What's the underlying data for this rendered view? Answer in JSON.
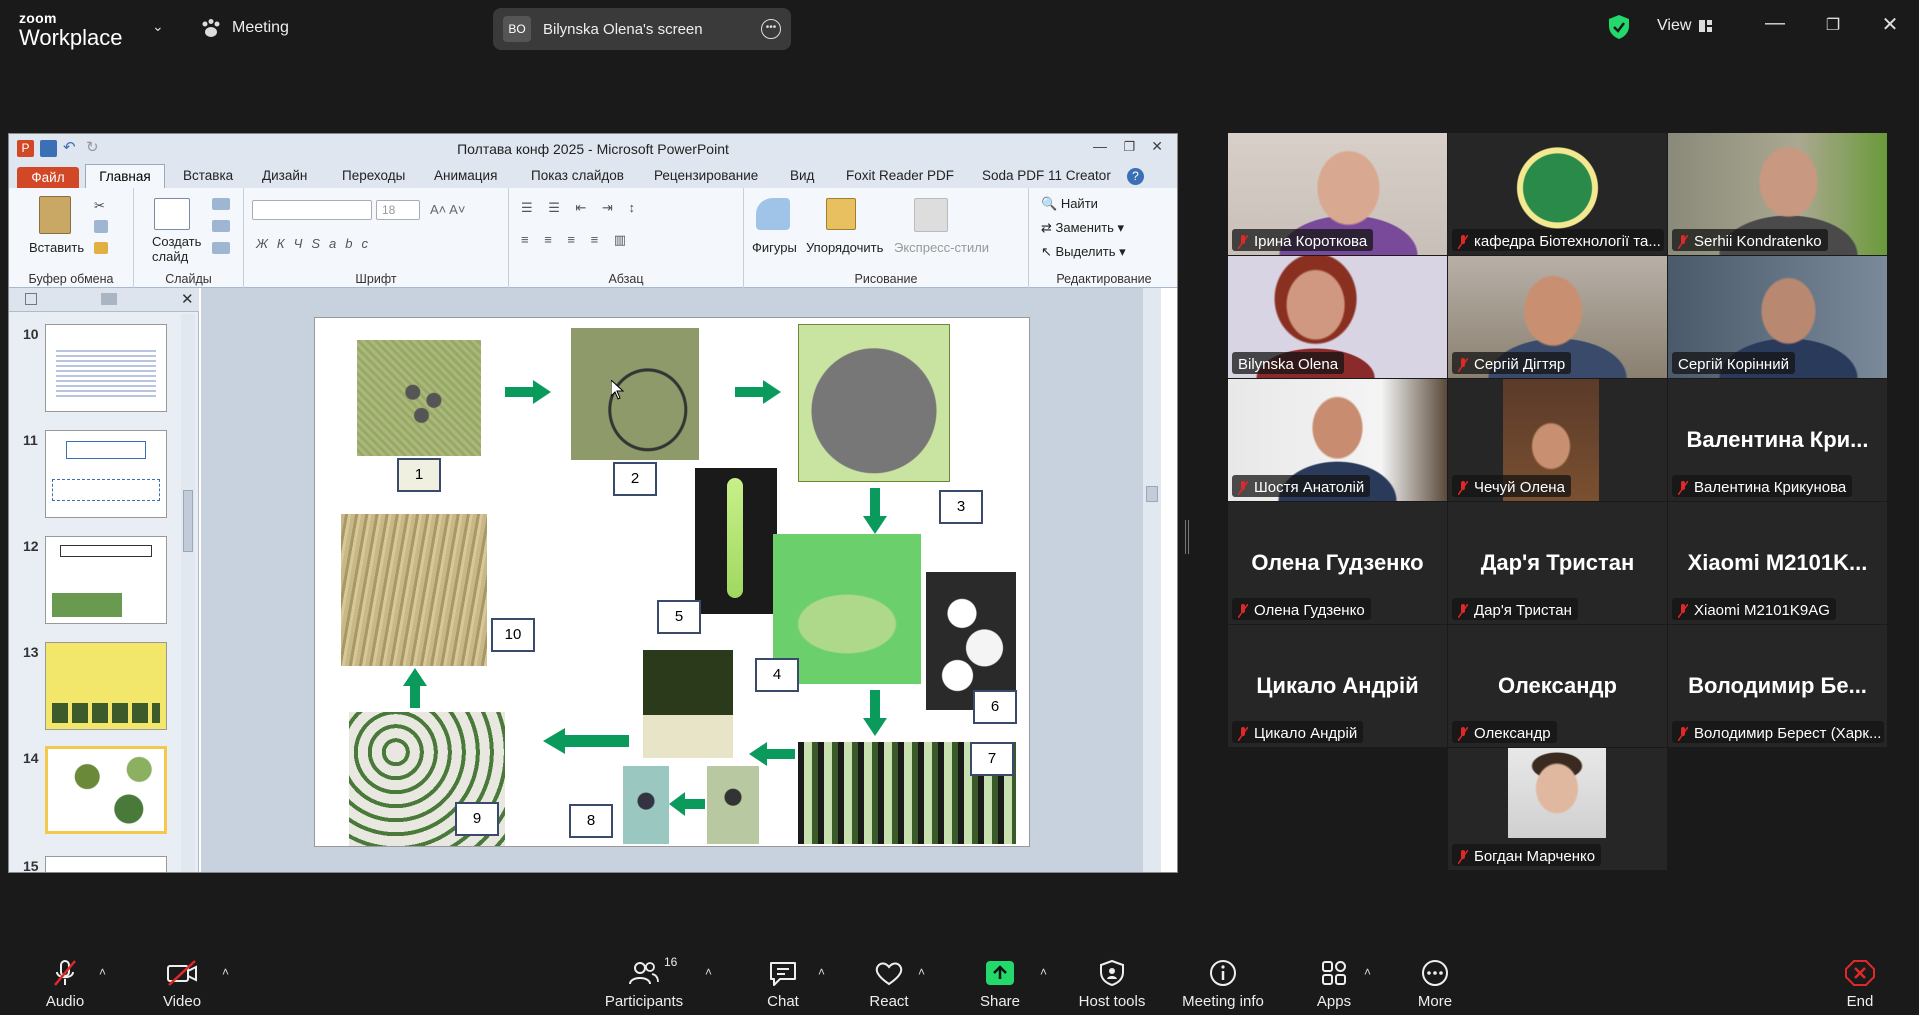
{
  "app": {
    "brand_top": "zoom",
    "brand_bottom": "Workplace",
    "meeting_label": "Meeting",
    "screen_initials": "BO",
    "screen_title": "Bilynska Olena's screen",
    "view_label": "View"
  },
  "ppt": {
    "window_title": "Полтава конф 2025  -  Microsoft PowerPoint",
    "tabs": [
      "Файл",
      "Главная",
      "Вставка",
      "Дизайн",
      "Переходы",
      "Анимация",
      "Показ слайдов",
      "Рецензирование",
      "Вид",
      "Foxit Reader PDF",
      "Soda PDF 11 Creator"
    ],
    "ribbon": {
      "paste": "Вставить",
      "create_slide": "Создать слайд",
      "font_size": "18",
      "shapes": "Фигуры",
      "arrange": "Упорядочить",
      "express": "Экспресс-стили",
      "find": "Найти",
      "replace": "Заменить",
      "select": "Выделить",
      "groups": [
        "Буфер обмена",
        "Слайды",
        "Шрифт",
        "Абзац",
        "Рисование",
        "Редактирование"
      ]
    },
    "thumb_numbers": [
      "10",
      "11",
      "12",
      "13",
      "14",
      "15"
    ],
    "slide_labels": [
      "1",
      "2",
      "3",
      "4",
      "5",
      "6",
      "7",
      "8",
      "9",
      "10"
    ]
  },
  "gallery": {
    "tiles": [
      {
        "name": "Ірина Короткова",
        "big": ""
      },
      {
        "name": "кафедра Біотехнології та...",
        "big": ""
      },
      {
        "name": "Serhii Kondratenko",
        "big": ""
      },
      {
        "name": "Bilynska Olena",
        "big": ""
      },
      {
        "name": "Сергій Дігтяр",
        "big": ""
      },
      {
        "name": "Сергій Корінний",
        "big": ""
      },
      {
        "name": "Шостя Анатолій",
        "big": ""
      },
      {
        "name": "Чечуй  Олена",
        "big": ""
      },
      {
        "name": "Валентина Крикунова",
        "big": "Валентина  Кри..."
      },
      {
        "name": "Олена Гудзенко",
        "big": "Олена Гудзенко"
      },
      {
        "name": "Дар'я Тристан",
        "big": "Дар'я Тристан"
      },
      {
        "name": "Xiaomi M2101K9AG",
        "big": "Xiaomi  M2101K..."
      },
      {
        "name": "Цикало Андрій",
        "big": "Цикало Андрій"
      },
      {
        "name": "Олександр",
        "big": "Олександр"
      },
      {
        "name": "Володимир Берест (Харк...",
        "big": "Володимир  Бе..."
      },
      {
        "name": "Богдан Марченко",
        "big": ""
      }
    ]
  },
  "toolbar": {
    "audio": "Audio",
    "video": "Video",
    "participants": "Participants",
    "participants_count": "16",
    "chat": "Chat",
    "react": "React",
    "share": "Share",
    "host_tools": "Host tools",
    "meeting_info": "Meeting info",
    "apps": "Apps",
    "more": "More",
    "end": "End"
  },
  "colors": {
    "share_green": "#23d96b",
    "end_red": "#e02828",
    "ppt_file_tab": "#d24726",
    "arrow_green": "#0a9a5c"
  }
}
